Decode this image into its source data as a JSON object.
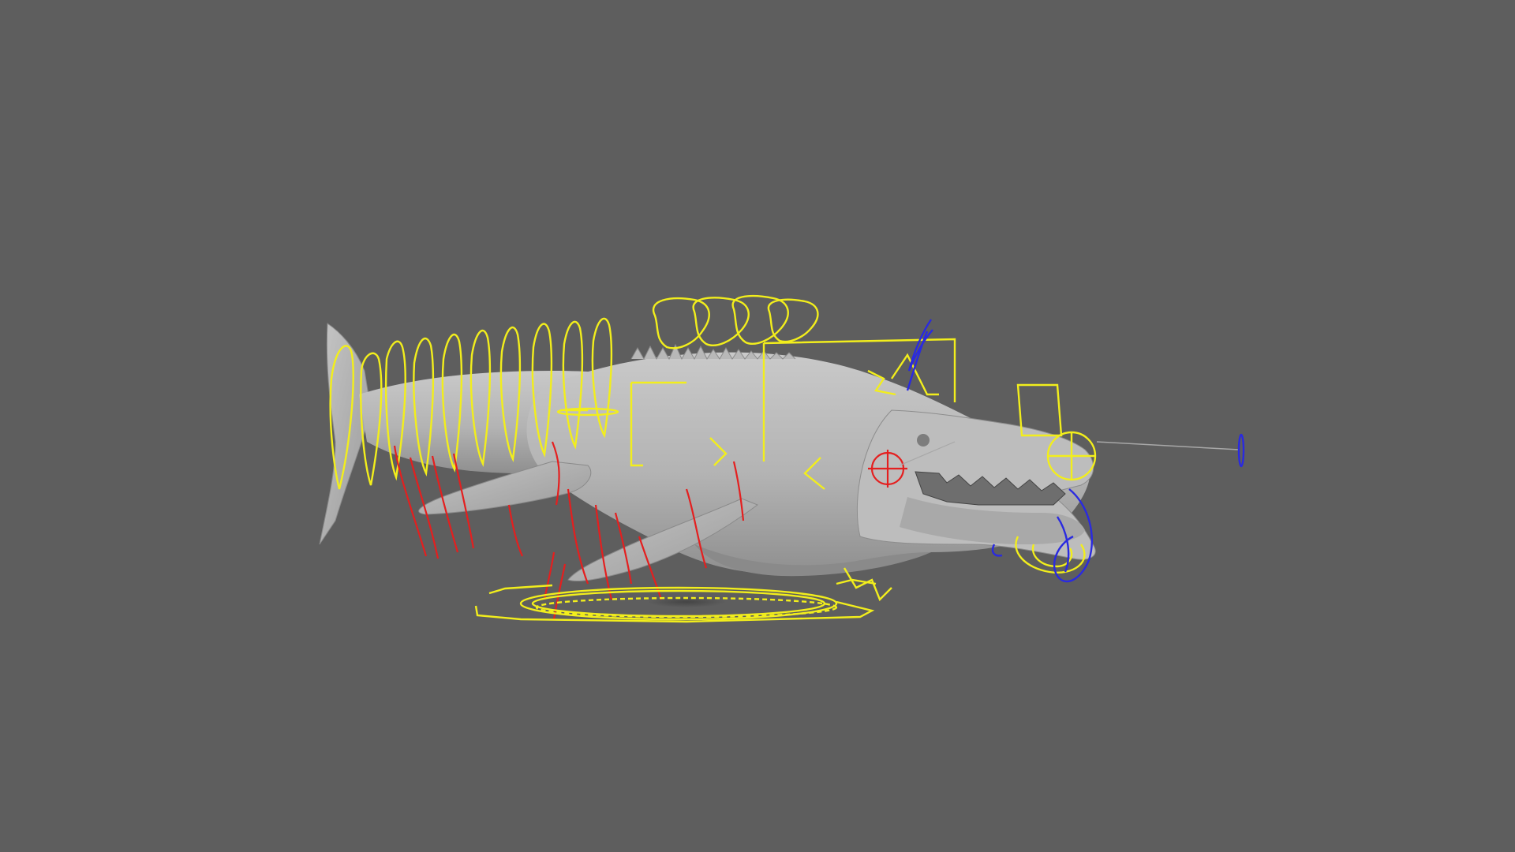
{
  "viewport": {
    "background_color": "#5e5e5e",
    "content": "rigged-creature-model"
  },
  "colors": {
    "mesh": "#b9b9b9",
    "mesh_shadow": "#8e8e8e",
    "control_yellow": "#f2ee1c",
    "control_red": "#e41f1f",
    "control_blue": "#2a2ae0",
    "guide_line": "#a8a8a8"
  },
  "rig": {
    "control_groups": [
      "spine-controls",
      "fin-controls",
      "head-controls",
      "root-control",
      "jaw-controls",
      "eye-aim-control"
    ]
  }
}
